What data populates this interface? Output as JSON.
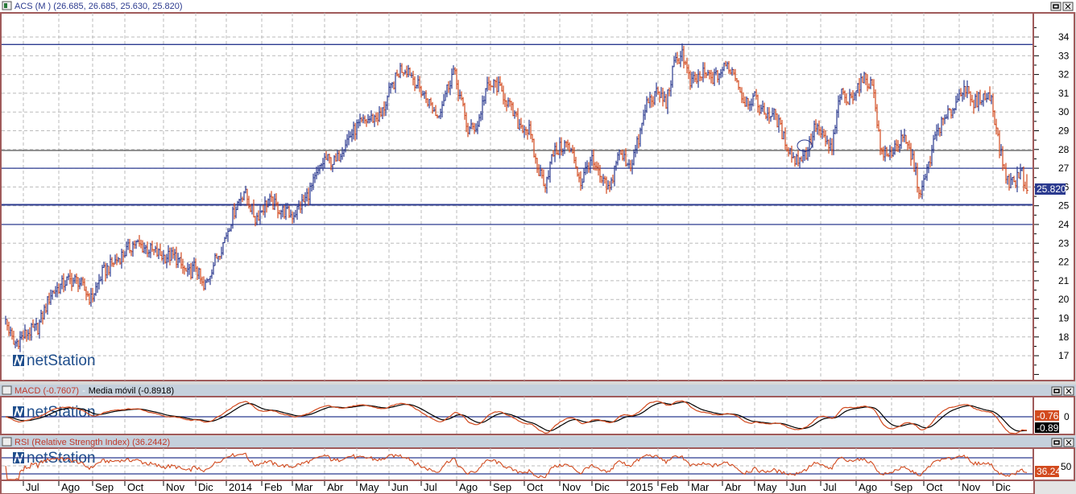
{
  "main_panel": {
    "symbol_title": "ACS (M )",
    "ohlc_readout": "(26.685, 26.685, 25.630, 25.820)",
    "last_price_tag": "25.820",
    "watermark": "netStation"
  },
  "macd_panel": {
    "macd_label": "MACD (-0.7607)",
    "separator": "-",
    "signal_label": "Media móvil (-0.8918)",
    "macd_tag": "-0.76",
    "signal_tag": "-0.89",
    "zero_label": "0",
    "watermark": "netStation"
  },
  "rsi_panel": {
    "label": "RSI (Relative Strength Index) (36.2442)",
    "rsi_tag": "36.24",
    "mid_label": "50",
    "watermark": "netStation"
  },
  "colors": {
    "up_bar": "#2b3a8f",
    "down_bar": "#d24a1e",
    "hline": "#2b3a8f",
    "frame": "#a05a5a",
    "macd": "#d24a1e",
    "signal": "#000000"
  },
  "chart_data": {
    "type": "ohlc",
    "title": "ACS (M )",
    "ylim": [
      16,
      34.8
    ],
    "y_ticks": [
      "34",
      "33",
      "32",
      "31",
      "30",
      "29",
      "28",
      "27",
      "26",
      "25",
      "24",
      "23",
      "22",
      "21",
      "20",
      "19",
      "18",
      "17"
    ],
    "horizontal_lines": [
      33.6,
      27.95,
      27.0,
      25.05,
      24.0
    ],
    "x_labels": [
      {
        "label": "Jul",
        "day": 13
      },
      {
        "label": "Ago",
        "day": 35
      },
      {
        "label": "Sep",
        "day": 56
      },
      {
        "label": "Oct",
        "day": 76
      },
      {
        "label": "Nov",
        "day": 100
      },
      {
        "label": "Dic",
        "day": 120
      },
      {
        "label": "2014",
        "day": 139
      },
      {
        "label": "Feb",
        "day": 161
      },
      {
        "label": "Mar",
        "day": 180
      },
      {
        "label": "Abr",
        "day": 200
      },
      {
        "label": "May",
        "day": 220
      },
      {
        "label": "Jun",
        "day": 240
      },
      {
        "label": "Jul",
        "day": 260
      },
      {
        "label": "Ago",
        "day": 282
      },
      {
        "label": "Sep",
        "day": 303
      },
      {
        "label": "Oct",
        "day": 324
      },
      {
        "label": "Nov",
        "day": 346
      },
      {
        "label": "Dic",
        "day": 366
      },
      {
        "label": "2015",
        "day": 388
      },
      {
        "label": "Feb",
        "day": 407
      },
      {
        "label": "Mar",
        "day": 426
      },
      {
        "label": "Abr",
        "day": 447
      },
      {
        "label": "May",
        "day": 467
      },
      {
        "label": "Jun",
        "day": 487
      },
      {
        "label": "Jul",
        "day": 508
      },
      {
        "label": "Ago",
        "day": 530
      },
      {
        "label": "Sep",
        "day": 552
      },
      {
        "label": "Oct",
        "day": 572
      },
      {
        "label": "Nov",
        "day": 594
      },
      {
        "label": "Dic",
        "day": 615
      }
    ],
    "close_points": [
      [
        2,
        18.9
      ],
      [
        7,
        17.6
      ],
      [
        15,
        18.2
      ],
      [
        22,
        18.5
      ],
      [
        30,
        20.3
      ],
      [
        40,
        21
      ],
      [
        47,
        21
      ],
      [
        55,
        20
      ],
      [
        62,
        21.4
      ],
      [
        72,
        22.2
      ],
      [
        82,
        23
      ],
      [
        90,
        22.7
      ],
      [
        100,
        22.3
      ],
      [
        107,
        22.3
      ],
      [
        115,
        21.3
      ],
      [
        120,
        21.8
      ],
      [
        125,
        20.5
      ],
      [
        130,
        21.7
      ],
      [
        137,
        23
      ],
      [
        145,
        25
      ],
      [
        150,
        25.8
      ],
      [
        157,
        24.3
      ],
      [
        165,
        25.3
      ],
      [
        172,
        24.8
      ],
      [
        180,
        24.5
      ],
      [
        187,
        25.2
      ],
      [
        192,
        26
      ],
      [
        200,
        27.5
      ],
      [
        207,
        27.3
      ],
      [
        212,
        28.3
      ],
      [
        220,
        29.2
      ],
      [
        227,
        29.6
      ],
      [
        235,
        29.8
      ],
      [
        240,
        31
      ],
      [
        247,
        32.3
      ],
      [
        252,
        32.3
      ],
      [
        257,
        31.5
      ],
      [
        265,
        30.5
      ],
      [
        270,
        29.8
      ],
      [
        275,
        31
      ],
      [
        280,
        32.2
      ],
      [
        285,
        30.5
      ],
      [
        289,
        29
      ],
      [
        295,
        29.3
      ],
      [
        300,
        31.2
      ],
      [
        306,
        31.5
      ],
      [
        312,
        30.8
      ],
      [
        320,
        29.4
      ],
      [
        327,
        29
      ],
      [
        332,
        27
      ],
      [
        337,
        26.2
      ],
      [
        342,
        27.8
      ],
      [
        350,
        28.3
      ],
      [
        355,
        27.5
      ],
      [
        359,
        26.2
      ],
      [
        365,
        27.5
      ],
      [
        372,
        26.3
      ],
      [
        377,
        25.8
      ],
      [
        382,
        27.8
      ],
      [
        390,
        27.2
      ],
      [
        395,
        28.5
      ],
      [
        400,
        30.5
      ],
      [
        407,
        31
      ],
      [
        412,
        30.5
      ],
      [
        417,
        32.5
      ],
      [
        422,
        33.2
      ],
      [
        427,
        31.5
      ],
      [
        435,
        32
      ],
      [
        442,
        31.8
      ],
      [
        450,
        32.5
      ],
      [
        455,
        32
      ],
      [
        460,
        30.6
      ],
      [
        467,
        30.7
      ],
      [
        472,
        30
      ],
      [
        480,
        29.8
      ],
      [
        485,
        28.6
      ],
      [
        492,
        27.4
      ],
      [
        499,
        27.8
      ],
      [
        505,
        29.3
      ],
      [
        510,
        28.5
      ],
      [
        515,
        28
      ],
      [
        520,
        31
      ],
      [
        525,
        30.5
      ],
      [
        530,
        31.3
      ],
      [
        536,
        31.8
      ],
      [
        541,
        31.2
      ],
      [
        545,
        28
      ],
      [
        550,
        27.6
      ],
      [
        555,
        28.3
      ],
      [
        560,
        28.5
      ],
      [
        565,
        27.5
      ],
      [
        570,
        25.5
      ],
      [
        575,
        27.2
      ],
      [
        580,
        29
      ],
      [
        587,
        29.8
      ],
      [
        592,
        30.5
      ],
      [
        597,
        31.5
      ],
      [
        602,
        30.3
      ],
      [
        607,
        30.8
      ],
      [
        614,
        30.8
      ],
      [
        619,
        28
      ],
      [
        624,
        26.3
      ],
      [
        629,
        26.3
      ],
      [
        632,
        27
      ],
      [
        636,
        25.8
      ]
    ],
    "last": {
      "open": 26.685,
      "high": 26.685,
      "low": 25.63,
      "close": 25.82
    },
    "macd": {
      "value": -0.7607,
      "signal": -0.8918
    },
    "rsi": {
      "value": 36.2442,
      "levels": [
        70,
        50,
        30
      ]
    }
  }
}
